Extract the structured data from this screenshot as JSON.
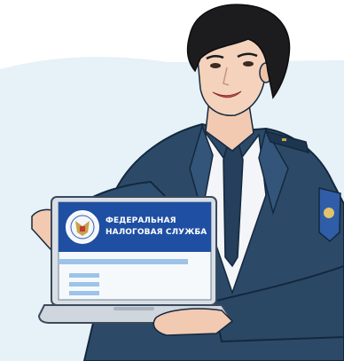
{
  "laptop_screen": {
    "title_line_1": "ФЕДЕРАЛЬНАЯ",
    "title_line_2": "НАЛОГОВАЯ СЛУЖБА",
    "emblem_icon": "double-headed-eagle-emblem-icon"
  },
  "colors": {
    "uniform": "#2c4a68",
    "header_band": "#1f4fa3",
    "form_lines": "#9dc3e8",
    "background_wash": "#e6f1f8"
  }
}
